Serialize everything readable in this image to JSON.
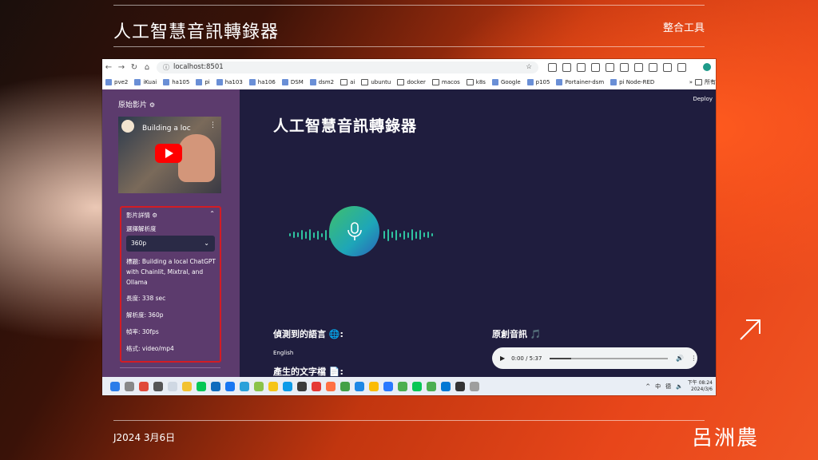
{
  "slide": {
    "title": "人工智慧音訊轉錄器",
    "tag": "整合工具",
    "date": "J2024 3月6日",
    "author": "呂洲農"
  },
  "browser": {
    "url": "localhost:8501",
    "bookmarks": [
      "pve2",
      "iKuai",
      "ha105",
      "pi",
      "ha103",
      "ha106",
      "DSM",
      "dsm2",
      "ai",
      "ubuntu",
      "docker",
      "macos",
      "k8s",
      "Google",
      "p105",
      "Portainer-dsm",
      "pi Node-RED"
    ],
    "bookmarks_more": "所有"
  },
  "sidebar": {
    "section_title": "原始影片",
    "video_title": "Building a loc",
    "details_header": "影片詳情",
    "resolution_label": "選擇解析度",
    "resolution_value": "360p",
    "fields": [
      "標題: Building a local ChatGPT with Chainlit, Mixtral, and Ollama",
      "長度: 338 sec",
      "解析度: 360p",
      "幀率: 30fps",
      "格式: video/mp4"
    ]
  },
  "main": {
    "deploy": "Deploy",
    "title": "人工智慧音訊轉錄器",
    "detected_language_label": "偵測到的語言 🌐:",
    "detected_language_value": "English",
    "generated_text_label": "產生的文字檔 📄:",
    "original_audio_label": "原創音訊 🎵",
    "audio_time": "0:00 / 5:37",
    "audio_progress": 0.18
  },
  "taskbar": {
    "ime1": "中",
    "ime2": "德",
    "time": "下午 08:24",
    "date": "2024/3/6"
  },
  "colors": {
    "accent": "#e8461a",
    "sidebar": "#5c3b6d",
    "main_bg": "#1f1d3e",
    "highlight": "#d31c24"
  }
}
